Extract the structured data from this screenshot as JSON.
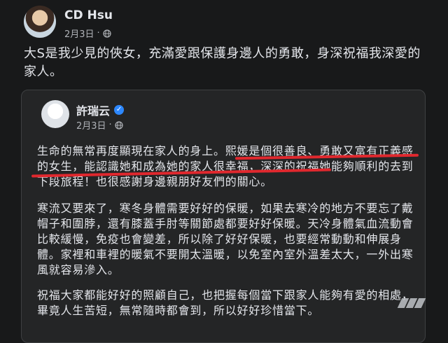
{
  "post": {
    "author": "CD Hsu",
    "date": "2月3日",
    "text": "大S是我少見的俠女，充滿愛跟保護身邊人的勇敢，身深祝福我深愛的家人。"
  },
  "shared_post": {
    "author": "許瑞云",
    "date": "2月3日",
    "paragraphs": [
      "生命的無常再度顯現在家人的身上。熙媛是個很善良、勇敢又富有正義感的女生，能認識她和成為她的家人很幸福，深深的祝福她能夠順利的去到下段旅程！也很感謝身邊親朋好友們的關心。",
      "寒流又要來了，寒冬身體需要好好的保暖，如果去寒冷的地方不要忘了戴帽子和圍脖，還有膝蓋手肘等關節處都要好好保暖。天冷身體氣血流動會比較緩慢，免疫也會變差，所以除了好好保暖，也要經常動動和伸展身體。家裡和車裡的暖氣不要開太溫暖，以免室內室外溫差太大，一外出寒風就容易滲入。",
      "祝福大家都能好好的照顧自己，也把握每個當下跟家人能夠有愛的相處，畢竟人生苦短，無常隨時都會到，所以好好珍惜當下。"
    ]
  },
  "colors": {
    "background": "#18191a",
    "card": "#242526",
    "highlight_underline": "#e0282e",
    "verified": "#2d88ff"
  },
  "icons": [
    "globe-icon",
    "verified-icon",
    "watermark-icon"
  ]
}
